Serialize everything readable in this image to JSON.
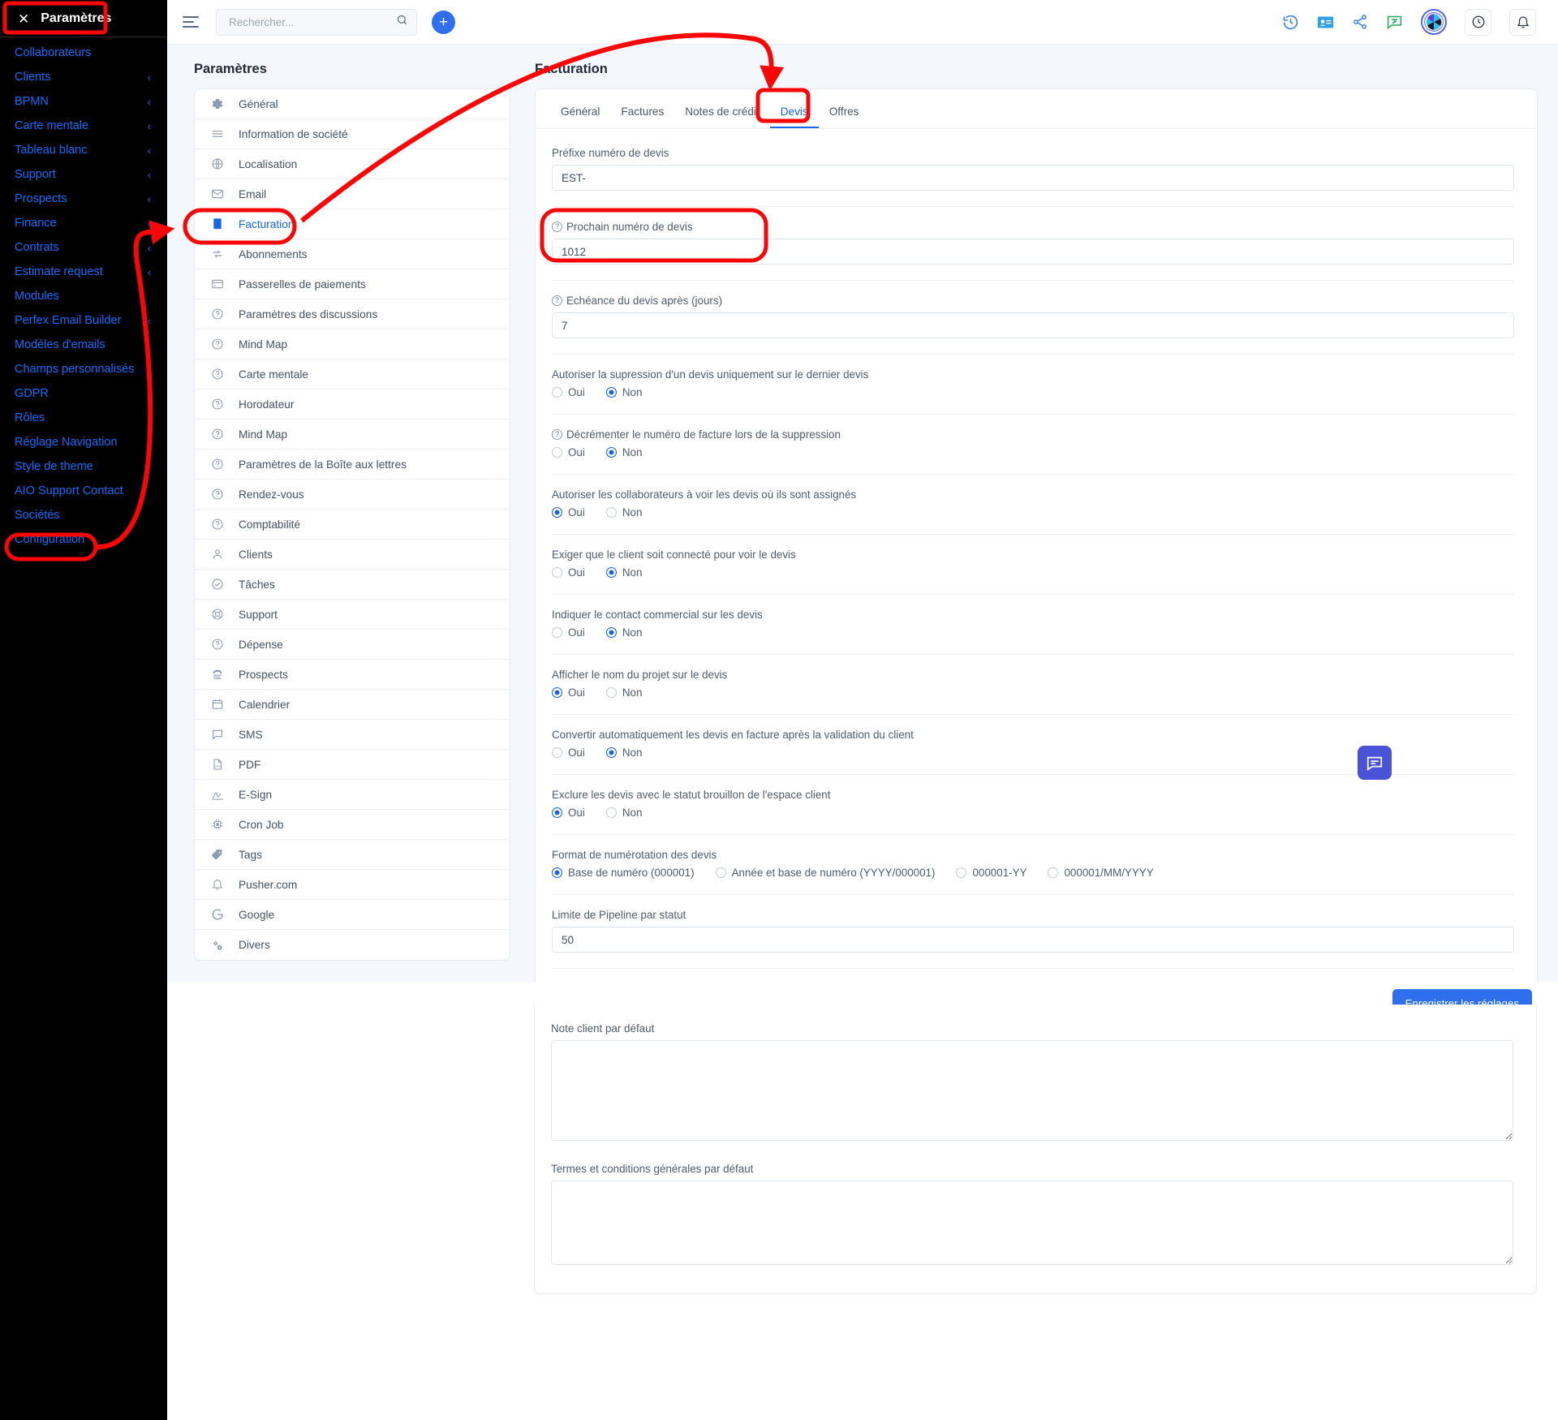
{
  "sidebar": {
    "title": "Paramètres",
    "close_icon": "close-icon",
    "items": [
      {
        "label": "Collaborateurs",
        "chevron": false
      },
      {
        "label": "Clients",
        "chevron": true
      },
      {
        "label": "BPMN",
        "chevron": true
      },
      {
        "label": "Carte mentale",
        "chevron": true
      },
      {
        "label": "Tableau blanc",
        "chevron": true
      },
      {
        "label": "Support",
        "chevron": true
      },
      {
        "label": "Prospects",
        "chevron": true
      },
      {
        "label": "Finance",
        "chevron": true
      },
      {
        "label": "Contrats",
        "chevron": true
      },
      {
        "label": "Estimate request",
        "chevron": true
      },
      {
        "label": "Modules",
        "chevron": false
      },
      {
        "label": "Perfex Email Builder",
        "chevron": true
      },
      {
        "label": "Modèles d'emails",
        "chevron": false
      },
      {
        "label": "Champs personnalisés",
        "chevron": false
      },
      {
        "label": "GDPR",
        "chevron": false
      },
      {
        "label": "Rôles",
        "chevron": false
      },
      {
        "label": "Réglage Navigation",
        "chevron": true
      },
      {
        "label": "Style de theme",
        "chevron": false
      },
      {
        "label": "AIO Support Contact",
        "chevron": false
      },
      {
        "label": "Sociétés",
        "chevron": false
      },
      {
        "label": "Configuration",
        "chevron": false
      }
    ]
  },
  "topbar": {
    "menu_icon": "hamburger-icon",
    "search_placeholder": "Rechercher...",
    "search_value": "",
    "search_icon": "search-icon",
    "add_label": "+",
    "icons": [
      "history-icon",
      "contact-card-icon",
      "share-icon",
      "chat-translate-icon",
      "app-logo-icon",
      "clock-icon",
      "bell-icon"
    ]
  },
  "settings_column": {
    "title": "Paramètres",
    "items": [
      {
        "label": "Général",
        "icon": "gear-icon",
        "active": false
      },
      {
        "label": "Information de société",
        "icon": "lines-icon",
        "active": false
      },
      {
        "label": "Localisation",
        "icon": "globe-icon",
        "active": false
      },
      {
        "label": "Email",
        "icon": "envelope-icon",
        "active": false
      },
      {
        "label": "Facturation",
        "icon": "receipt-icon",
        "active": true
      },
      {
        "label": "Abonnements",
        "icon": "refresh-icon",
        "active": false
      },
      {
        "label": "Passerelles de paiements",
        "icon": "credit-card-icon",
        "active": false
      },
      {
        "label": "Paramètres des discussions",
        "icon": "question-icon",
        "active": false
      },
      {
        "label": "Mind Map",
        "icon": "question-icon",
        "active": false
      },
      {
        "label": "Carte mentale",
        "icon": "question-icon",
        "active": false
      },
      {
        "label": "Horodateur",
        "icon": "question-icon",
        "active": false
      },
      {
        "label": "Mind Map",
        "icon": "question-icon",
        "active": false
      },
      {
        "label": "Paramètres de la Boîte aux lettres",
        "icon": "question-icon",
        "active": false
      },
      {
        "label": "Rendez-vous",
        "icon": "question-icon",
        "active": false
      },
      {
        "label": "Comptabilité",
        "icon": "question-icon",
        "active": false
      },
      {
        "label": "Clients",
        "icon": "user-icon",
        "active": false
      },
      {
        "label": "Tâches",
        "icon": "check-circle-icon",
        "active": false
      },
      {
        "label": "Support",
        "icon": "lifebuoy-icon",
        "active": false
      },
      {
        "label": "Dépense",
        "icon": "question-icon",
        "active": false
      },
      {
        "label": "Prospects",
        "icon": "phone-icon",
        "active": false
      },
      {
        "label": "Calendrier",
        "icon": "calendar-icon",
        "active": false
      },
      {
        "label": "SMS",
        "icon": "speech-bubble-icon",
        "active": false
      },
      {
        "label": "PDF",
        "icon": "pdf-file-icon",
        "active": false
      },
      {
        "label": "E-Sign",
        "icon": "signature-icon",
        "active": false
      },
      {
        "label": "Cron Job",
        "icon": "chip-icon",
        "active": false
      },
      {
        "label": "Tags",
        "icon": "tag-icon",
        "active": false
      },
      {
        "label": "Pusher.com",
        "icon": "bell-icon",
        "active": false
      },
      {
        "label": "Google",
        "icon": "google-g-icon",
        "active": false
      },
      {
        "label": "Divers",
        "icon": "gears-icon",
        "active": false
      }
    ]
  },
  "facturation": {
    "title": "Facturation",
    "tabs": [
      {
        "label": "Général",
        "active": false
      },
      {
        "label": "Factures",
        "active": false
      },
      {
        "label": "Notes de crédit",
        "active": false
      },
      {
        "label": "Devis",
        "active": true
      },
      {
        "label": "Offres",
        "active": false
      }
    ],
    "fields": {
      "prefix": {
        "label": "Préfixe numéro de devis",
        "value": "EST-",
        "help": false
      },
      "next_number": {
        "label": "Prochain numéro de devis",
        "value": "1012",
        "help": true
      },
      "due_days": {
        "label": "Echéance du devis après (jours)",
        "value": "7",
        "help": true
      },
      "pipeline_limit": {
        "label": "Limite de Pipeline par statut",
        "value": "50",
        "help": false
      }
    },
    "yes_label": "Oui",
    "no_label": "Non",
    "toggles": [
      {
        "label": "Autoriser la supression d'un devis uniquement sur le dernier devis",
        "help": false,
        "selected": "Non"
      },
      {
        "label": "Décrémenter le numéro de facture lors de la suppression",
        "help": true,
        "selected": "Non"
      },
      {
        "label": "Autoriser les collaborateurs à voir les devis où ils sont assignés",
        "help": false,
        "selected": "Oui"
      },
      {
        "label": "Exiger que le client soit connecté pour voir le devis",
        "help": false,
        "selected": "Non"
      },
      {
        "label": "Indiquer le contact commercial sur les devis",
        "help": false,
        "selected": "Non"
      },
      {
        "label": "Afficher le nom du projet sur le devis",
        "help": false,
        "selected": "Oui"
      },
      {
        "label": "Convertir automatiquement les devis en facture après la validation du client",
        "help": false,
        "selected": "Non"
      },
      {
        "label": "Exclure les devis avec le statut brouillon de l'espace client",
        "help": false,
        "selected": "Oui"
      }
    ],
    "numbering": {
      "label": "Format de numérotation des devis",
      "options": [
        {
          "label": "Base de numéro (000001)",
          "selected": true
        },
        {
          "label": "Année et base de numéro (YYYY/000001)",
          "selected": false
        },
        {
          "label": "000001-YY",
          "selected": false
        },
        {
          "label": "000001/MM/YYYY",
          "selected": false
        }
      ]
    },
    "note_client": {
      "label": "Note client par défaut",
      "value": ""
    },
    "terms": {
      "label": "Termes et conditions générales par défaut",
      "value": ""
    },
    "save_label": "Enregistrer les réglages"
  },
  "chat_fab": {
    "icon": "chat-bubble-icon"
  },
  "annotations": {
    "accent_color": "#fb0606",
    "highlights": [
      "sidebar-title",
      "sidebar-configuration",
      "settings-facturation",
      "tab-devis",
      "next-number-field"
    ]
  }
}
